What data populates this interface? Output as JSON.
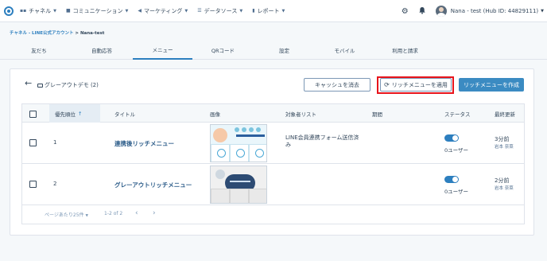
{
  "nav": {
    "items": [
      {
        "label": "チャネル",
        "icon": "chat-icon"
      },
      {
        "label": "コミュニケーション",
        "icon": "message-icon"
      },
      {
        "label": "マーケティング",
        "icon": "megaphone-icon"
      },
      {
        "label": "データソース",
        "icon": "list-icon"
      },
      {
        "label": "レポート",
        "icon": "bar-chart-icon"
      }
    ],
    "user": "Nana - test (Hub ID: 44829111)"
  },
  "breadcrumb": {
    "link": "チャネル - LINE公式アカウント",
    "separator": " > ",
    "current": "Nana-test"
  },
  "tabs": [
    "友だち",
    "自動応答",
    "メニュー",
    "QRコード",
    "設定",
    "モバイル",
    "利用と請求"
  ],
  "active_tab": "メニュー",
  "panel": {
    "folder_title": "グレーアウトデモ (2)",
    "clear_cache": "キャッシュを消去",
    "apply_rich_menu": "リッチメニューを適用",
    "create_rich_menu": "リッチメニューを作成"
  },
  "table": {
    "headers": {
      "priority": "優先順位",
      "sort_arrow": "↑",
      "title": "タイトル",
      "image": "画像",
      "target": "対象者リスト",
      "period": "期間",
      "status": "ステータス",
      "updated": "最終更新"
    },
    "rows": [
      {
        "priority": "1",
        "title": "連携後リッチメニュー",
        "target": "LINE会員連携フォーム送信済み",
        "status_users": "0ユーザー",
        "updated": "3分前",
        "updated_by": "岩本 奈菜"
      },
      {
        "priority": "2",
        "title": "グレーアウトリッチメニュー",
        "target": "",
        "status_users": "0ユーザー",
        "updated": "2分前",
        "updated_by": "岩本 奈菜"
      }
    ],
    "pagination": {
      "per_page": "ページあたり25件",
      "range": "1-2 of 2"
    }
  }
}
